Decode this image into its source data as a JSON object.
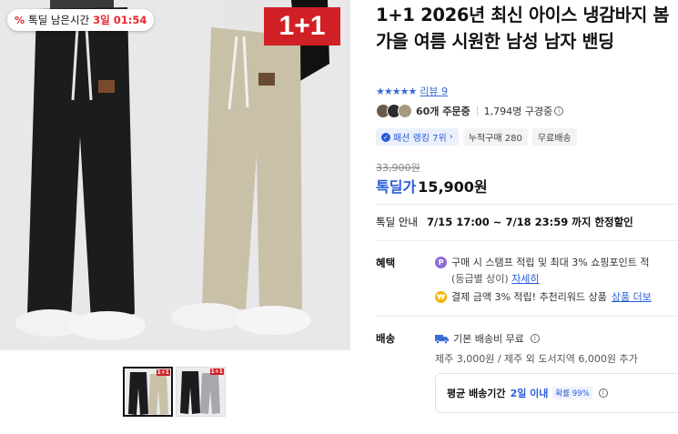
{
  "deal_badge": {
    "icon": "percent-icon",
    "label": "톡딜 남은시간",
    "days": "3일",
    "time": "01:54"
  },
  "plus_badge": "1+1",
  "thumbnails": [
    {
      "mini": "1+1"
    },
    {
      "mini": "1+1"
    }
  ],
  "product": {
    "title": "1+1 2026년 최신 아이스 냉감바지 봄 가을 여름 시원한 남성 남자 밴딩",
    "rating_stars": "★★★★★",
    "review_link": "리뷰 9",
    "order_count": "60개 주문중",
    "subscribers": "1,794명 구경중"
  },
  "chips": {
    "rank": "패션 랭킹 7위",
    "rank_arrow": "›",
    "cumulative": "누적구매 280",
    "free_ship": "무료배송"
  },
  "price": {
    "original": "33,900원",
    "deal_label": "톡딜가",
    "current": "15,900원"
  },
  "notice": {
    "label": "톡딜 안내",
    "value": "7/15 17:00 ~ 7/18 23:59 까지 한정할인"
  },
  "benefits": {
    "label": "혜택",
    "line1": "구매 시 스탬프 적립 및 최대 3% 쇼핑포인트 적",
    "line1_sub": "(등급별 상이)",
    "line1_link": "자세히",
    "line2": "결제 금액 3% 적립! 추천리워드 상품",
    "line2_link": "상품 더보"
  },
  "shipping": {
    "label": "배송",
    "base": "기본 배송비 무료",
    "extra": "제주 3,000원 / 제주 외 도서지역 6,000원 추가",
    "avg_label": "평균 배송기간",
    "avg_days": "2일 이내",
    "probability": "확률 99%"
  },
  "colors": {
    "accent_blue": "#2a5bd7",
    "deal_red": "#e8292e",
    "badge_red": "#d11f26"
  }
}
